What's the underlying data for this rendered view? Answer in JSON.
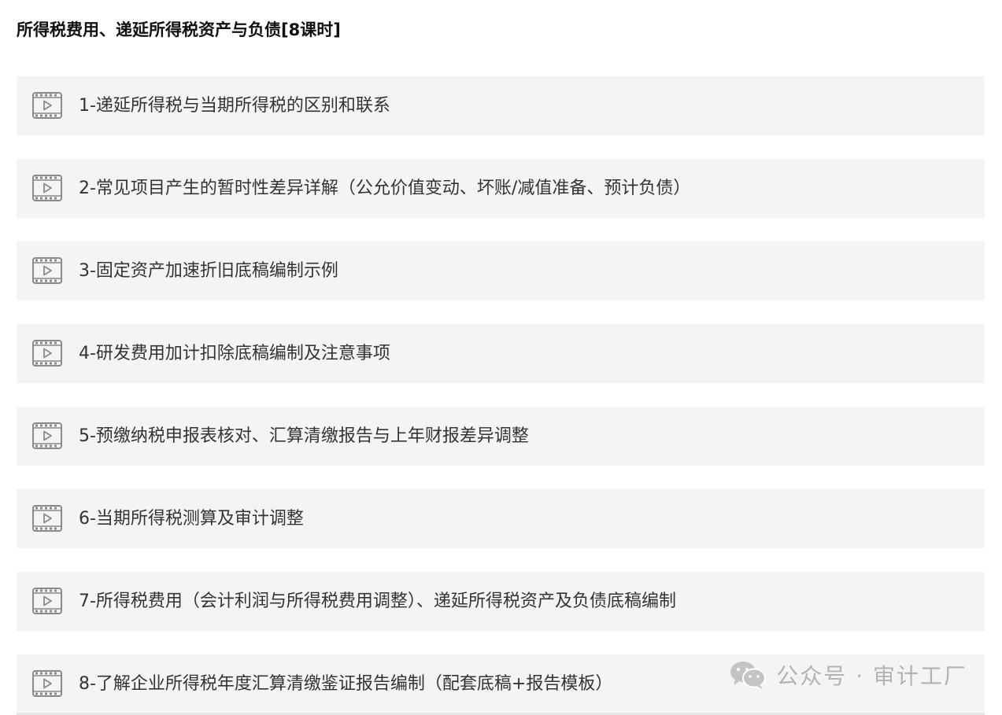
{
  "section": {
    "title": "所得税费用、递延所得税资产与负债[8课时]"
  },
  "lessons": [
    {
      "label": "1-递延所得税与当期所得税的区别和联系",
      "icon": "video-icon"
    },
    {
      "label": "2-常见项目产生的暂时性差异详解（公允价值变动、坏账/减值准备、预计负债）",
      "icon": "video-icon"
    },
    {
      "label": "3-固定资产加速折旧底稿编制示例",
      "icon": "video-icon"
    },
    {
      "label": "4-研发费用加计扣除底稿编制及注意事项",
      "icon": "video-icon"
    },
    {
      "label": "5-预缴纳税申报表核对、汇算清缴报告与上年财报差异调整",
      "icon": "video-icon"
    },
    {
      "label": "6-当期所得税测算及审计调整",
      "icon": "video-icon"
    },
    {
      "label": "7-所得税费用（会计利润与所得税费用调整）、递延所得税资产及负债底稿编制",
      "icon": "video-icon"
    },
    {
      "label": "8-了解企业所得税年度汇算清缴鉴证报告编制（配套底稿+报告模板）",
      "icon": "video-icon"
    }
  ],
  "watermark": {
    "text": "公众号 · 审计工厂",
    "icon": "wechat-icon"
  },
  "colors": {
    "row_background": "#f4f4f4",
    "label_text": "#333333",
    "icon_stroke": "#8a8a8a",
    "watermark": "#b3b3b3"
  }
}
